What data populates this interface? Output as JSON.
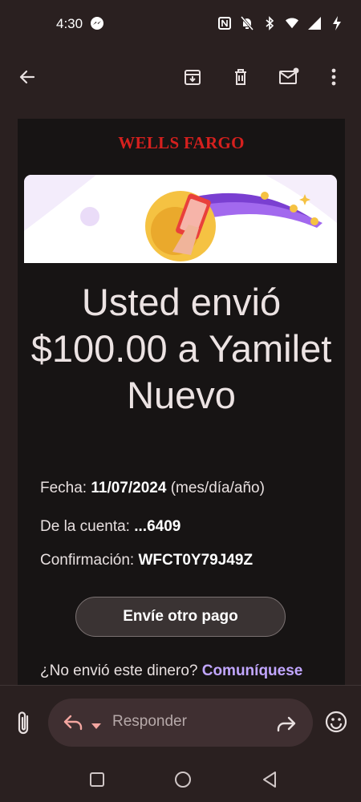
{
  "status_bar": {
    "time": "4:30",
    "icons": [
      "messenger-icon",
      "nfc-icon",
      "bell-off-icon",
      "bluetooth-icon",
      "wifi-icon",
      "signal-icon",
      "charging-icon"
    ]
  },
  "toolbar": {
    "icons": [
      "back-arrow-icon",
      "archive-icon",
      "delete-icon",
      "mark-unread-icon",
      "more-vert-icon"
    ]
  },
  "email": {
    "brand": "WELLS FARGO",
    "headline": "Usted envió $100.00 a Yamilet Nuevo",
    "date_label": "Fecha:",
    "date_value": "11/07/2024",
    "date_format": "(mes/día/año)",
    "account_label": "De la cuenta:",
    "account_value": "...6409",
    "confirm_label": "Confirmación:",
    "confirm_value": "WFCT0Y79J49Z",
    "cta_label": "Envíe otro pago",
    "footer_question": "¿No envió este dinero?",
    "footer_link": "Comuníquese"
  },
  "reply_bar": {
    "placeholder": "Responder",
    "icons": [
      "attach-icon",
      "reply-icon",
      "dropdown-icon",
      "forward-icon",
      "emoji-icon"
    ]
  },
  "colors": {
    "background": "#2a2020",
    "email_bg": "#171414",
    "brand_red": "#d6201e",
    "link_purple": "#c1a6ff"
  }
}
